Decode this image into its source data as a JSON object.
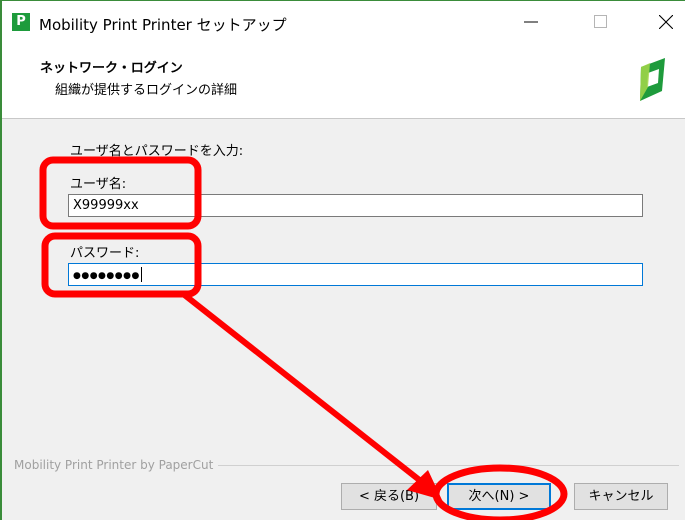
{
  "window": {
    "title": "Mobility Print Printer セットアップ",
    "app_icon_letter": "P",
    "frame_color": "#3a8c3a"
  },
  "header": {
    "title": "ネットワーク・ログイン",
    "subtitle": "組織が提供するログインの詳細"
  },
  "form": {
    "prompt": "ユーザ名とパスワードを入力:",
    "username_label": "ユーザ名:",
    "username_value": "X99999xx",
    "password_label": "パスワード:",
    "password_value": "●●●●●●●●"
  },
  "footer": {
    "brand": "Mobility Print Printer by PaperCut",
    "back_label": "< 戻る(B)",
    "next_label": "次へ(N) >",
    "cancel_label": "キャンセル"
  },
  "icons": {
    "minimize": "minimize-icon",
    "maximize": "maximize-icon",
    "close": "close-icon",
    "logo": "papercut-logo-icon"
  },
  "colors": {
    "logo_green": "#1e9b3c",
    "logo_light": "#a6d84a",
    "annotation_red": "#ff0000",
    "focus_blue": "#0078d7"
  }
}
